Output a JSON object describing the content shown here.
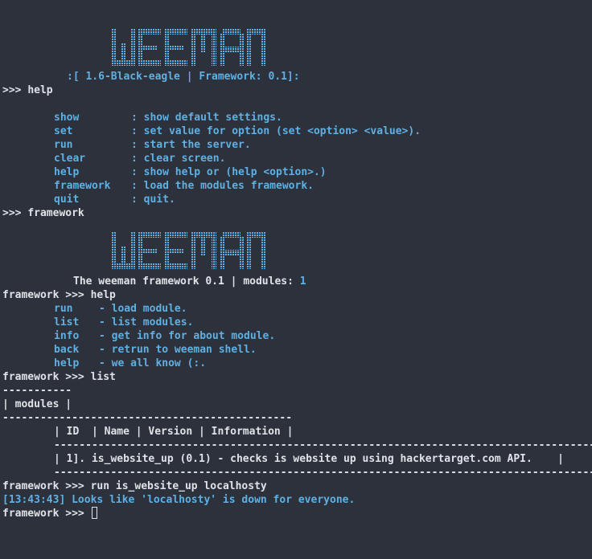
{
  "colors": {
    "background": "#2c313b",
    "text": "#dfe3e8",
    "accent": "#5fb0e3"
  },
  "banner_logo": "WEEMAN",
  "version_line": ":[ 1.6-Black-eagle | Framework: 0.1]:",
  "prompt_main": ">>> ",
  "prompt_fw": "framework >>> ",
  "cmd_help": "help",
  "cmd_framework": "framework",
  "help_rows": [
    {
      "cmd": "show",
      "desc": ": show default settings."
    },
    {
      "cmd": "set",
      "desc": ": set value for option (set <option> <value>)."
    },
    {
      "cmd": "run",
      "desc": ": start the server."
    },
    {
      "cmd": "clear",
      "desc": ": clear screen."
    },
    {
      "cmd": "help",
      "desc": ": show help or (help <option>.)"
    },
    {
      "cmd": "framework",
      "desc": ": load the modules framework."
    },
    {
      "cmd": "quit",
      "desc": ": quit."
    }
  ],
  "fw_info_text": "The weeman framework 0.1 | modules: ",
  "fw_info_count": "1",
  "fw_cmd_help": "help",
  "fw_help_rows": [
    {
      "cmd": "run",
      "desc": "- load module."
    },
    {
      "cmd": "list",
      "desc": "- list modules."
    },
    {
      "cmd": "info",
      "desc": "- get info for about module."
    },
    {
      "cmd": "back",
      "desc": "- retrun to weeman shell."
    },
    {
      "cmd": "help",
      "desc": "- we all know (:."
    }
  ],
  "fw_cmd_list": "list",
  "modules_table": {
    "sep_short": "-----------",
    "title": "| modules |",
    "sep_long": "----------------------------------------------",
    "header": "| ID  | Name | Version | Information |",
    "sep_row": "------------------------------------------------------------------------------------------",
    "row": "| 1]. is_website_up (0.1) - checks is website up using hackertarget.com API.    |"
  },
  "fw_cmd_run": "run is_website_up localhosty",
  "result_line": "[13:43:43] Looks like 'localhosty' is down for everyone."
}
